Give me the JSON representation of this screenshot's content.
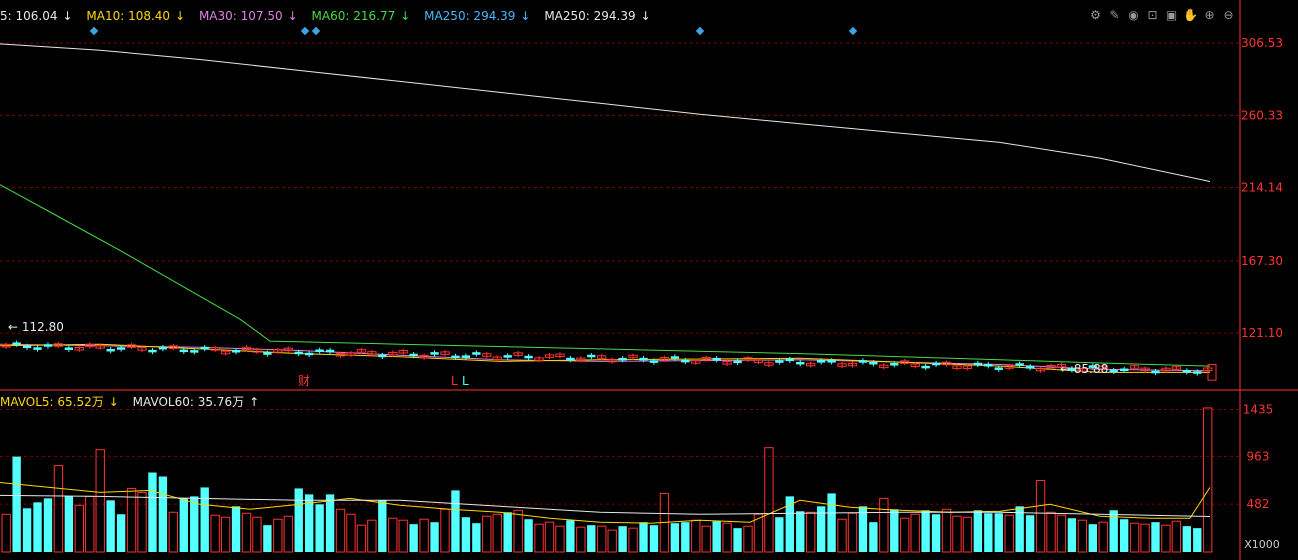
{
  "legend_main": [
    {
      "label": "5: 106.04",
      "arrow": "↓",
      "color": "#e8e8e8"
    },
    {
      "label": "MA10: 108.40",
      "arrow": "↓",
      "color": "#ffd700"
    },
    {
      "label": "MA30: 107.50",
      "arrow": "↓",
      "color": "#e080e0"
    },
    {
      "label": "MA60: 216.77",
      "arrow": "↓",
      "color": "#44dd44"
    },
    {
      "label": "MA250: 294.39",
      "arrow": "↓",
      "color": "#44bbff"
    },
    {
      "label": "MA250: 294.39",
      "arrow": "↓",
      "color": "#e8e8e8"
    }
  ],
  "legend_vol": [
    {
      "label": "MAVOL5: 65.52万",
      "arrow": "↓",
      "color": "#ffd700"
    },
    {
      "label": "MAVOL60: 35.76万",
      "arrow": "↑",
      "color": "#e8e8e8"
    }
  ],
  "toolbar_icons": [
    "gear-icon",
    "pen-icon",
    "eye-icon",
    "lock-icon",
    "bag-icon",
    "hand-icon",
    "plus-icon",
    "minus-icon"
  ],
  "markers": {
    "cai": "财",
    "l_red": "L",
    "l_cyan": "L",
    "high": "112.80",
    "low": "85.88"
  },
  "colors": {
    "up": "#ff3232",
    "down": "#54ffff",
    "grid": "#7a0000",
    "axis": "#ff3232"
  },
  "chart_data": [
    {
      "type": "line",
      "title": "",
      "y_ticks": [
        306.53,
        260.33,
        214.14,
        167.3,
        121.1
      ],
      "ylim": [
        86,
        320
      ],
      "series": [
        {
          "name": "MA250",
          "color": "#e8e8e8",
          "x": [
            0,
            100,
            200,
            300,
            400,
            500,
            600,
            700,
            800,
            900,
            1000,
            1100,
            1210
          ],
          "values": [
            306,
            302,
            296,
            289,
            282,
            275,
            268,
            261,
            255,
            249,
            243,
            233,
            218
          ]
        },
        {
          "name": "MA60",
          "color": "#44dd44",
          "x": [
            0,
            60,
            120,
            180,
            240,
            270,
            400,
            600,
            800,
            1000,
            1100,
            1210
          ],
          "values": [
            216,
            195,
            174,
            152,
            130,
            116,
            114,
            111,
            108,
            104,
            102,
            100
          ]
        },
        {
          "name": "MA30",
          "color": "#e080e0",
          "x": [
            0,
            100,
            200,
            300,
            400,
            500,
            600,
            800,
            1000,
            1100,
            1210
          ],
          "values": [
            114,
            113,
            112,
            110,
            107,
            104,
            103,
            104,
            101,
            98,
            97
          ]
        },
        {
          "name": "MA10",
          "color": "#ffd700",
          "x": [
            0,
            100,
            200,
            300,
            400,
            500,
            600,
            800,
            1000,
            1100,
            1210
          ],
          "values": [
            113,
            114,
            111,
            108,
            106,
            103,
            104,
            105,
            100,
            96,
            96
          ]
        }
      ]
    },
    {
      "type": "bar",
      "title": "",
      "y_ticks": [
        1435,
        963,
        482
      ],
      "unit": "X1000",
      "ylim": [
        0,
        1530
      ],
      "volumes": [
        380,
        960,
        440,
        500,
        540,
        870,
        560,
        470,
        560,
        1030,
        520,
        380,
        640,
        600,
        800,
        760,
        400,
        540,
        560,
        650,
        370,
        350,
        460,
        390,
        350,
        270,
        330,
        360,
        640,
        580,
        480,
        580,
        430,
        380,
        270,
        320,
        520,
        340,
        320,
        280,
        330,
        300,
        430,
        620,
        350,
        290,
        360,
        380,
        400,
        420,
        330,
        280,
        300,
        260,
        320,
        250,
        270,
        260,
        220,
        260,
        240,
        300,
        270,
        590,
        290,
        300,
        320,
        260,
        310,
        290,
        240,
        260,
        380,
        1050,
        350,
        560,
        410,
        400,
        460,
        590,
        330,
        390,
        460,
        300,
        540,
        430,
        340,
        380,
        420,
        380,
        430,
        360,
        350,
        420,
        390,
        390,
        370,
        460,
        370,
        720,
        400,
        370,
        340,
        320,
        280,
        300,
        420,
        330,
        290,
        280,
        300,
        270,
        310,
        260,
        240,
        1450
      ],
      "up": [
        1,
        0,
        0,
        0,
        0,
        1,
        0,
        1,
        1,
        1,
        0,
        0,
        1,
        1,
        0,
        0,
        1,
        0,
        0,
        0,
        1,
        1,
        0,
        1,
        1,
        0,
        1,
        1,
        0,
        0,
        0,
        0,
        1,
        1,
        1,
        1,
        0,
        1,
        1,
        0,
        1,
        0,
        1,
        0,
        0,
        0,
        1,
        1,
        0,
        1,
        0,
        1,
        1,
        1,
        0,
        1,
        0,
        1,
        1,
        0,
        1,
        0,
        0,
        1,
        0,
        0,
        1,
        1,
        0,
        1,
        0,
        1,
        1,
        1,
        0,
        0,
        0,
        1,
        0,
        0,
        1,
        1,
        0,
        0,
        1,
        0,
        1,
        1,
        0,
        0,
        1,
        1,
        1,
        0,
        0,
        0,
        1,
        0,
        0,
        1,
        1,
        1,
        0,
        1,
        0,
        1,
        0,
        0,
        1,
        1,
        0,
        1,
        1,
        0,
        0,
        1
      ],
      "ma5_x": [
        0,
        100,
        150,
        200,
        250,
        300,
        350,
        400,
        450,
        500,
        550,
        600,
        650,
        700,
        750,
        800,
        850,
        900,
        950,
        1000,
        1050,
        1100,
        1150,
        1190,
        1210
      ],
      "ma5_values": [
        700,
        600,
        620,
        480,
        430,
        480,
        540,
        470,
        430,
        400,
        340,
        300,
        290,
        320,
        300,
        520,
        450,
        420,
        400,
        410,
        480,
        360,
        340,
        340,
        650
      ],
      "ma60_x": [
        0,
        100,
        200,
        300,
        400,
        500,
        600,
        700,
        800,
        900,
        1000,
        1100,
        1210
      ],
      "ma60_values": [
        570,
        560,
        540,
        520,
        520,
        460,
        400,
        380,
        390,
        400,
        400,
        380,
        357
      ]
    }
  ]
}
